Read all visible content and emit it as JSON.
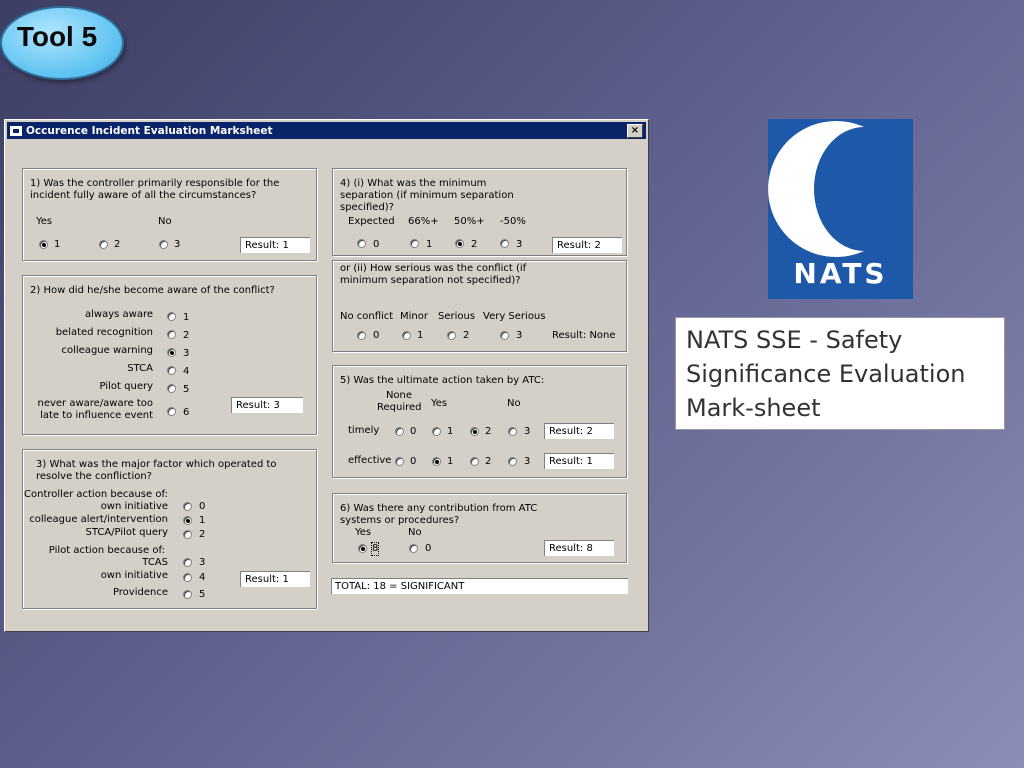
{
  "badge": "Tool 5",
  "window": {
    "title": "Occurence Incident Evaluation Marksheet",
    "close": "×"
  },
  "q1": {
    "question": "1) Was the controller primarily responsible for the incident fully aware of all the circumstances?",
    "header_yes": "Yes",
    "header_no": "No",
    "options": [
      "1",
      "2",
      "3"
    ],
    "selected": "1",
    "result": "Result:  1"
  },
  "q2": {
    "question": "2) How did he/she become aware of the conflict?",
    "labels": [
      "always aware",
      "belated recognition",
      "colleague warning",
      "STCA",
      "Pilot query",
      "never aware/aware too late to influence event"
    ],
    "options": [
      "1",
      "2",
      "3",
      "4",
      "5",
      "6"
    ],
    "selected": "3",
    "result": "Result:  3"
  },
  "q3": {
    "question": "3) What was the major factor which operated to resolve the confliction?",
    "controller_heading": "Controller action because of:",
    "pilot_heading": "Pilot action because of:",
    "labels": [
      "own initiative",
      "colleague alert/intervention",
      "STCA/Pilot query",
      "TCAS",
      "own initiative",
      "Providence"
    ],
    "options": [
      "0",
      "1",
      "2",
      "3",
      "4",
      "5"
    ],
    "selected": "1",
    "result": "Result:  1"
  },
  "q4": {
    "question": "4) (i) What was the minimum separation (if minimum separation specified)?",
    "headers": [
      "Expected",
      "66%+",
      "50%+",
      "-50%"
    ],
    "options": [
      "0",
      "1",
      "2",
      "3"
    ],
    "selected": "2",
    "result": "Result:  2"
  },
  "q4b": {
    "question": "or (ii) How serious was the conflict (if minimum separation not specified)?",
    "headers": [
      "No conflict",
      "Minor",
      "Serious",
      "Very Serious"
    ],
    "options": [
      "0",
      "1",
      "2",
      "3"
    ],
    "selected": "",
    "result": "Result: None"
  },
  "q5": {
    "question": "5) Was the ultimate action taken by ATC:",
    "header_none": "None Required",
    "header_yes": "Yes",
    "header_no": "No",
    "rows": [
      {
        "label": "timely",
        "options": [
          "0",
          "1",
          "2",
          "3"
        ],
        "selected": "2",
        "result": "Result:  2"
      },
      {
        "label": "effective",
        "options": [
          "0",
          "1",
          "2",
          "3"
        ],
        "selected": "1",
        "result": "Result:  1"
      }
    ]
  },
  "q6": {
    "question": "6) Was there any contribution from ATC systems or procedures?",
    "header_yes": "Yes",
    "header_no": "No",
    "options": [
      "8",
      "0"
    ],
    "selected": "8",
    "result": "Result:  8"
  },
  "total": "TOTAL:  18 = SIGNIFICANT",
  "logo_text": "NATS",
  "caption": "NATS SSE - Safety Significance Evaluation Mark-sheet",
  "colors": {
    "titlebar": "#0a246a",
    "window": "#d4d0c8",
    "logo": "#1e58a8"
  }
}
